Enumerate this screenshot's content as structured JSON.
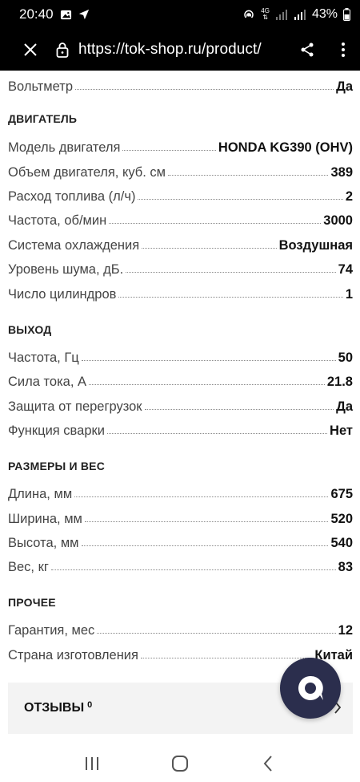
{
  "status_bar": {
    "time": "20:40",
    "battery": "43%",
    "network": "4G"
  },
  "browser": {
    "url": "https://tok-shop.ru/product/"
  },
  "top_row": {
    "label": "Вольтметр",
    "value": "Да"
  },
  "sections": [
    {
      "title": "ДВИГАТЕЛЬ",
      "rows": [
        {
          "label": "Модель двигателя",
          "value": "HONDA KG390 (OHV)"
        },
        {
          "label": "Объем двигателя, куб. см",
          "value": "389"
        },
        {
          "label": "Расход топлива (л/ч)",
          "value": "2"
        },
        {
          "label": "Частота, об/мин",
          "value": "3000"
        },
        {
          "label": "Система охлаждения",
          "value": "Воздушная"
        },
        {
          "label": "Уровень шума, дБ.",
          "value": "74"
        },
        {
          "label": "Число цилиндров",
          "value": "1"
        }
      ]
    },
    {
      "title": "ВЫХОД",
      "rows": [
        {
          "label": "Частота, Гц",
          "value": "50"
        },
        {
          "label": "Сила тока, А",
          "value": "21.8"
        },
        {
          "label": "Защита от перегрузок",
          "value": "Да"
        },
        {
          "label": "Функция сварки",
          "value": "Нет"
        }
      ]
    },
    {
      "title": "РАЗМЕРЫ И ВЕС",
      "rows": [
        {
          "label": "Длина, мм",
          "value": "675"
        },
        {
          "label": "Ширина, мм",
          "value": "520"
        },
        {
          "label": "Высота, мм",
          "value": "540"
        },
        {
          "label": "Вес, кг",
          "value": "83"
        }
      ]
    },
    {
      "title": "ПРОЧЕЕ",
      "rows": [
        {
          "label": "Гарантия, мес",
          "value": "12"
        },
        {
          "label": "Страна изготовления",
          "value": "Китай"
        }
      ]
    }
  ],
  "reviews": {
    "label": "ОТЗЫВЫ",
    "count": "0"
  }
}
